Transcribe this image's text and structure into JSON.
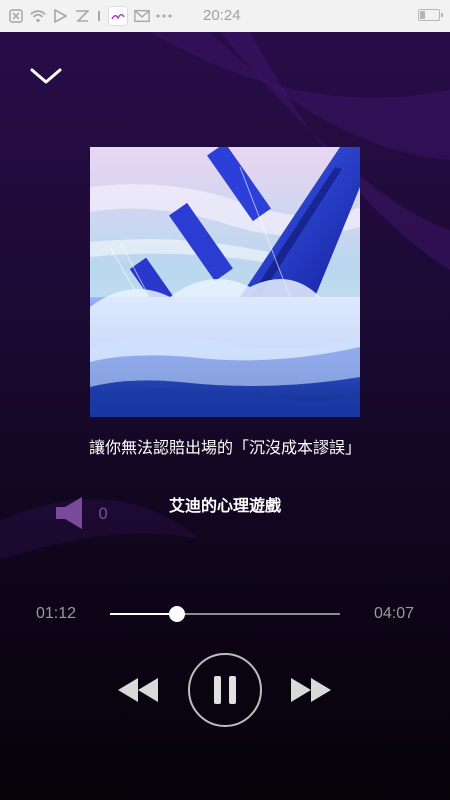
{
  "statusbar": {
    "time": "20:24",
    "icons": [
      "notification-icon",
      "wifi-icon",
      "play-store-icon",
      "vpn-icon",
      "app-icon",
      "mail-icon",
      "more-dots-icon",
      "battery-icon"
    ]
  },
  "player": {
    "collapse_icon": "chevron-down-icon",
    "title": "讓你無法認賠出場的「沉沒成本謬誤」",
    "artist": "艾迪的心理遊戲",
    "volume": "0",
    "current_time": "01:12",
    "total_time": "04:07",
    "progress": 0.29
  },
  "colors": {
    "accent_purple": "#7a4a9a",
    "bg_top": "#2a0d4a",
    "bg_bottom": "#050208"
  }
}
